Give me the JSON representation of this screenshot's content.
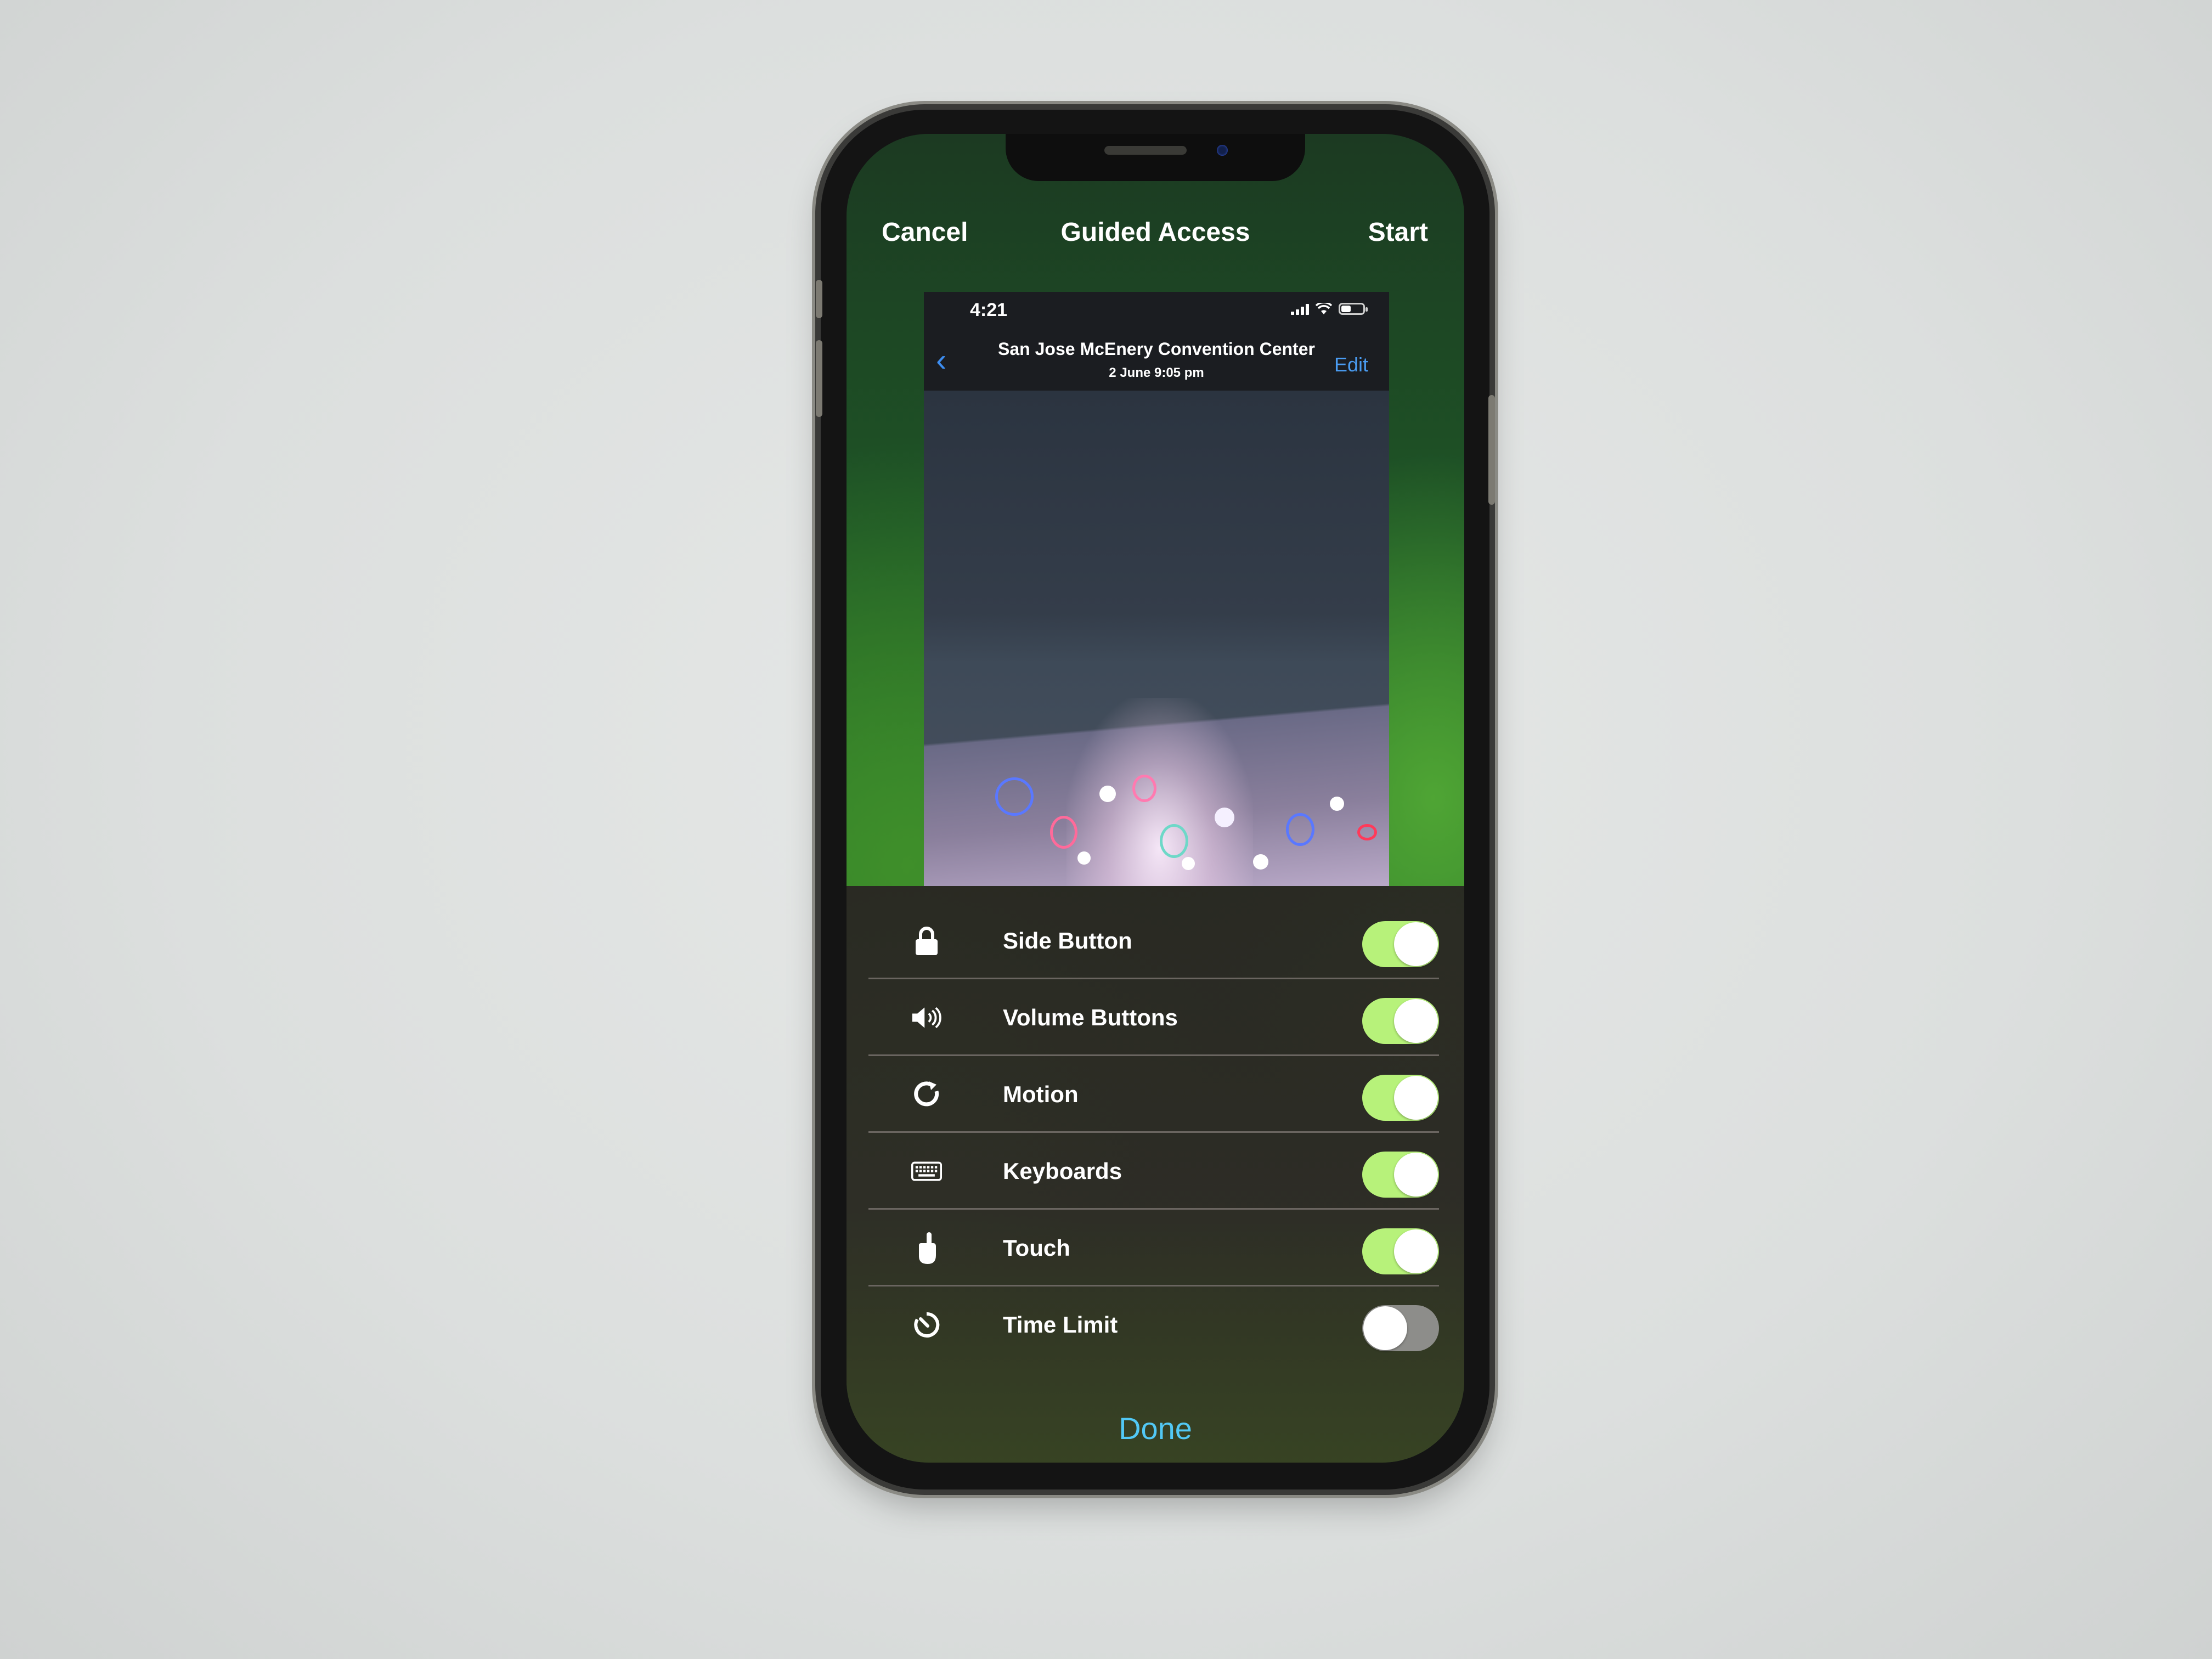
{
  "header": {
    "cancel_label": "Cancel",
    "title": "Guided Access",
    "start_label": "Start"
  },
  "preview": {
    "status_time": "4:21",
    "nav_title": "San Jose McEnery Convention Center",
    "nav_subtitle": "2 June  9:05 pm",
    "back_icon": "chevron-left-icon",
    "edit_label": "Edit"
  },
  "options": [
    {
      "label": "Side Button",
      "icon": "lock-icon",
      "on": true
    },
    {
      "label": "Volume Buttons",
      "icon": "speaker-icon",
      "on": true
    },
    {
      "label": "Motion",
      "icon": "rotate-icon",
      "on": true
    },
    {
      "label": "Keyboards",
      "icon": "keyboard-icon",
      "on": true
    },
    {
      "label": "Touch",
      "icon": "hand-pointer-icon",
      "on": true
    },
    {
      "label": "Time Limit",
      "icon": "timer-icon",
      "on": false
    }
  ],
  "done_label": "Done",
  "colors": {
    "toggle_on": "#b7f27a",
    "toggle_off": "#8d8d8a",
    "link_blue": "#52c8f5",
    "edit_blue": "#4a9cf2"
  }
}
